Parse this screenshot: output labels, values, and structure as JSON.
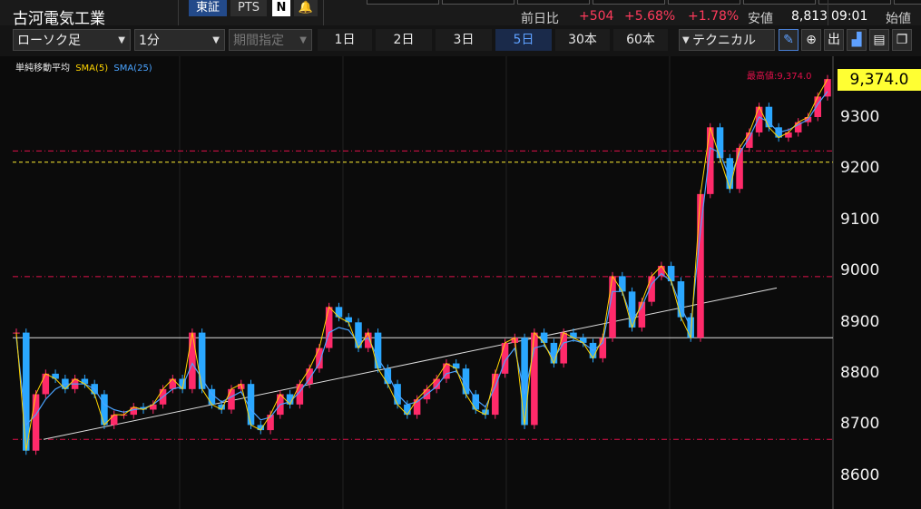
{
  "header": {
    "title": "古河電気工業",
    "exchange_tab": "東証",
    "pts_tab": "PTS",
    "change_label": "前日比",
    "change_value": "+504",
    "change_pct": "+5.68%",
    "change_pct2": "+1.78%",
    "low_label": "安値",
    "low_value": "8,813",
    "time": "09:01",
    "open_label": "始値"
  },
  "controls": {
    "chart_type": "ローソク足",
    "interval": "1分",
    "range": "期間指定",
    "periods": [
      "1日",
      "2日",
      "3日",
      "5日",
      "30本",
      "60本"
    ],
    "active_period": "5日",
    "technical": "テクニカル"
  },
  "legend": {
    "title": "単純移動平均",
    "sma5": "SMA(5)",
    "sma25": "SMA(25)"
  },
  "colors": {
    "up": "#ff2a6a",
    "down": "#2aa7ff",
    "sma5": "#ffd400",
    "sma25": "#4aa3ff",
    "accent": "#5ea0ff",
    "price_tag": "#ffff33",
    "high_line": "#e0104a",
    "yellow_line": "#ffee33"
  },
  "chart": {
    "current_price": "9,374.0",
    "high_label": "最高値:9,374.0",
    "y_ticks": [
      "9300",
      "9200",
      "9100",
      "9000",
      "8900",
      "8800",
      "8700",
      "8600"
    ]
  },
  "chart_data": {
    "type": "candlestick",
    "ylim": [
      8560,
      9400
    ],
    "y_ticks": [
      9300,
      9200,
      9100,
      9000,
      8900,
      8800,
      8700,
      8600
    ],
    "last": 9374.0,
    "high": 9374.0,
    "reference_lines": [
      {
        "y": 9234,
        "style": "dashdot",
        "color": "#e0104a"
      },
      {
        "y": 9212,
        "style": "dashed",
        "color": "#ffee33"
      },
      {
        "y": 8989,
        "style": "dashdot",
        "color": "#e0104a"
      },
      {
        "y": 8870,
        "style": "solid",
        "color": "#dddddd"
      },
      {
        "y": 8672,
        "style": "dashdot",
        "color": "#e0104a"
      }
    ],
    "trendline": {
      "from": 8672,
      "to": 8967
    },
    "day_boundaries": 4,
    "series": [
      {
        "name": "SMA(5)",
        "values": [
          8880,
          8650,
          8760,
          8800,
          8790,
          8770,
          8790,
          8780,
          8760,
          8700,
          8720,
          8720,
          8735,
          8730,
          8740,
          8770,
          8790,
          8770,
          8880,
          8770,
          8740,
          8730,
          8770,
          8780,
          8700,
          8690,
          8720,
          8760,
          8740,
          8780,
          8810,
          8850,
          8930,
          8910,
          8900,
          8850,
          8880,
          8810,
          8780,
          8740,
          8720,
          8750,
          8770,
          8790,
          8820,
          8810,
          8760,
          8730,
          8720,
          8800,
          8860,
          8870,
          8700,
          8880,
          8860,
          8820,
          8880,
          8870,
          8860,
          8830,
          8870,
          8990,
          8960,
          8890,
          8940,
          8990,
          9010,
          8980,
          8910,
          8870,
          9150,
          9280,
          9220,
          9160,
          9240,
          9270,
          9320,
          9280,
          9260,
          9270,
          9290,
          9300,
          9340,
          9374
        ]
      },
      {
        "name": "SMA(25)",
        "values": [
          8870,
          8700,
          8720,
          8750,
          8770,
          8780,
          8780,
          8780,
          8770,
          8740,
          8730,
          8725,
          8730,
          8732,
          8740,
          8755,
          8770,
          8775,
          8820,
          8790,
          8760,
          8745,
          8755,
          8765,
          8730,
          8710,
          8715,
          8740,
          8745,
          8765,
          8790,
          8820,
          8880,
          8890,
          8885,
          8860,
          8870,
          8830,
          8800,
          8760,
          8740,
          8745,
          8760,
          8775,
          8800,
          8805,
          8780,
          8750,
          8735,
          8775,
          8825,
          8850,
          8760,
          8850,
          8855,
          8830,
          8860,
          8865,
          8860,
          8845,
          8860,
          8960,
          8960,
          8905,
          8930,
          8975,
          8995,
          8980,
          8930,
          8890,
          9080,
          9240,
          9230,
          9180,
          9230,
          9260,
          9300,
          9290,
          9270,
          9275,
          9285,
          9295,
          9325,
          9350
        ]
      }
    ]
  }
}
